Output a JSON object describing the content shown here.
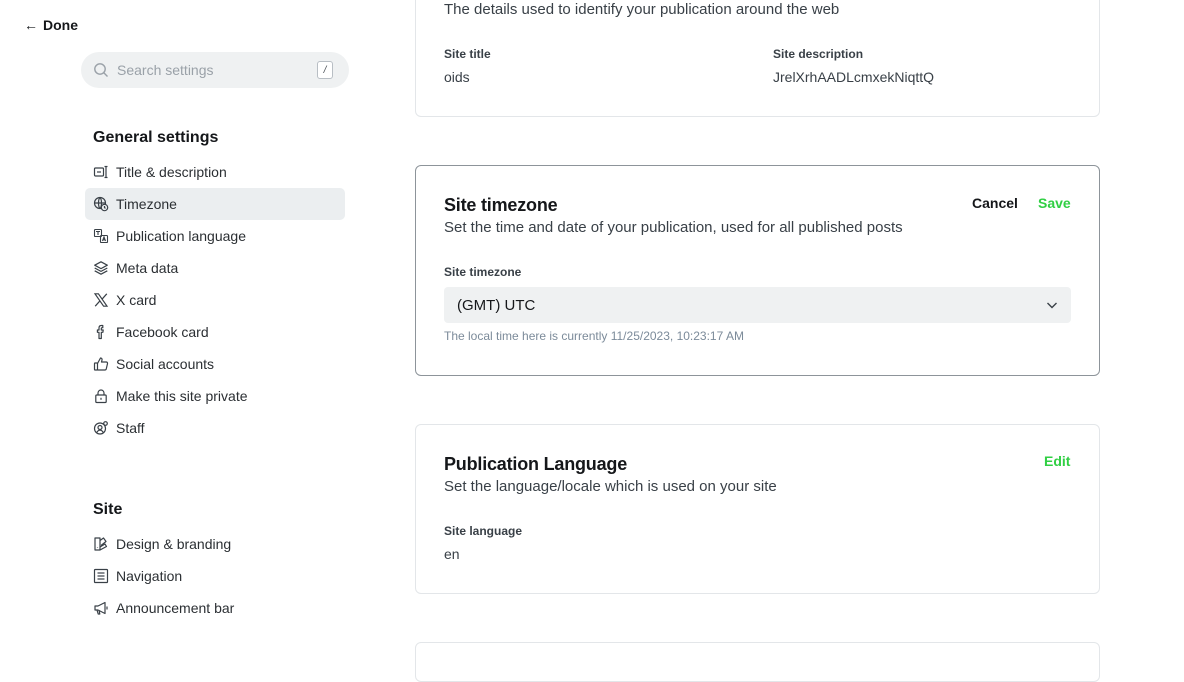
{
  "header": {
    "done_arrow": "←",
    "done_label": "Done"
  },
  "search": {
    "placeholder": "Search settings",
    "shortcut": "/"
  },
  "sidebar": {
    "general_title": "General settings",
    "general_items": [
      {
        "label": "Title & description",
        "icon": "title-description-icon"
      },
      {
        "label": "Timezone",
        "icon": "globe-clock-icon",
        "active": true
      },
      {
        "label": "Publication language",
        "icon": "language-icon"
      },
      {
        "label": "Meta data",
        "icon": "layers-icon"
      },
      {
        "label": "X card",
        "icon": "x-logo-icon"
      },
      {
        "label": "Facebook card",
        "icon": "facebook-icon"
      },
      {
        "label": "Social accounts",
        "icon": "thumbs-up-icon"
      },
      {
        "label": "Make this site private",
        "icon": "lock-icon"
      },
      {
        "label": "Staff",
        "icon": "staff-icon"
      }
    ],
    "site_title": "Site",
    "site_items": [
      {
        "label": "Design & branding",
        "icon": "brush-icon"
      },
      {
        "label": "Navigation",
        "icon": "navigation-icon"
      },
      {
        "label": "Announcement bar",
        "icon": "megaphone-icon"
      }
    ]
  },
  "title_card": {
    "desc": "The details used to identify your publication around the web",
    "site_title_label": "Site title",
    "site_title_value": "oids",
    "site_desc_label": "Site description",
    "site_desc_value": "JrelXrhAADLcmxekNiqttQ"
  },
  "timezone_card": {
    "title": "Site timezone",
    "desc": "Set the time and date of your publication, used for all published posts",
    "cancel": "Cancel",
    "save": "Save",
    "field_label": "Site timezone",
    "selected": "(GMT) UTC",
    "hint": "The local time here is currently 11/25/2023, 10:23:17 AM"
  },
  "language_card": {
    "title": "Publication Language",
    "desc": "Set the language/locale which is used on your site",
    "edit": "Edit",
    "field_label": "Site language",
    "value": "en"
  },
  "colors": {
    "accent_green": "#30cf43",
    "active_bg": "#ebeef0",
    "search_bg": "#eff1f2"
  }
}
